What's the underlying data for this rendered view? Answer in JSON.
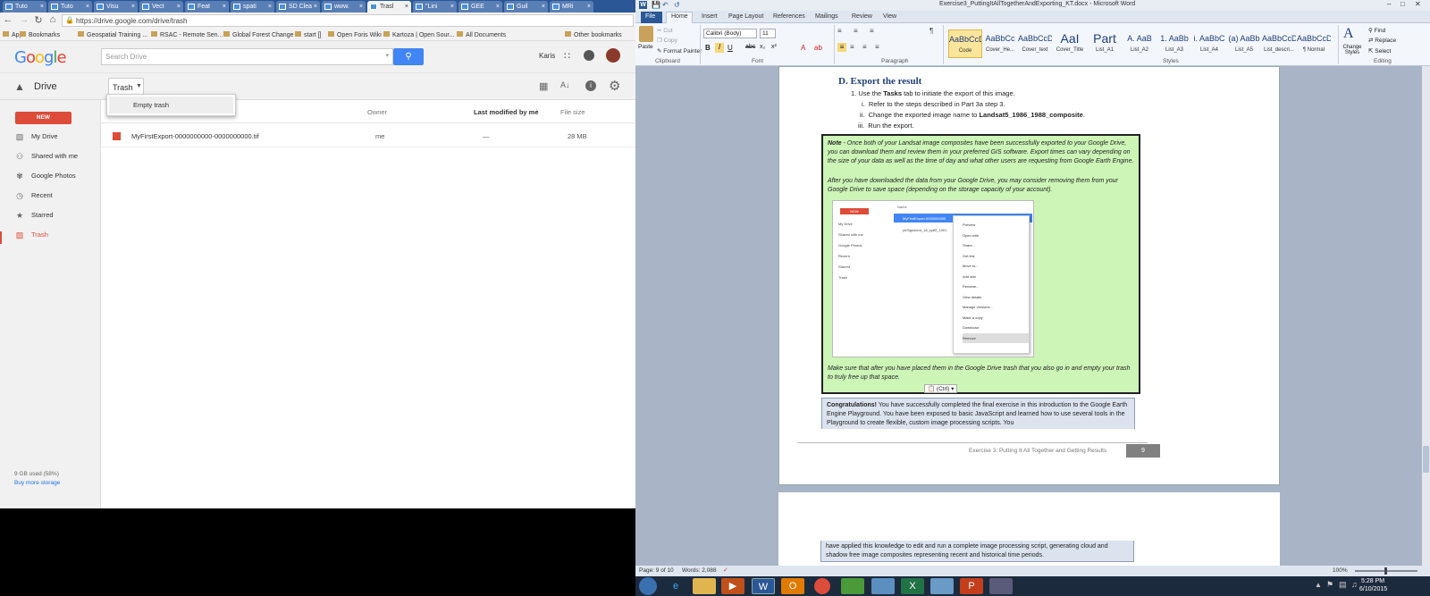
{
  "chrome": {
    "tabs": [
      {
        "label": "Tuto"
      },
      {
        "label": "Tuto"
      },
      {
        "label": "Visu"
      },
      {
        "label": "Vect"
      },
      {
        "label": "Feat"
      },
      {
        "label": "spati"
      },
      {
        "label": "SD Clea"
      },
      {
        "label": "www."
      },
      {
        "label": "Trasl"
      },
      {
        "label": "\"Lini"
      },
      {
        "label": "GEE"
      },
      {
        "label": "Guil"
      },
      {
        "label": "MRi"
      }
    ],
    "url": "https://drive.google.com/drive/trash",
    "bookmarks": [
      "Apps",
      "Bookmarks",
      "Geospatial Training ...",
      "RSAC - Remote Sen...",
      "Global Forest Change",
      "start []",
      "Open Foris Wiki",
      "Kartoza | Open Sour...",
      "All Documents",
      "Other bookmarks"
    ]
  },
  "drive": {
    "logo": "Google",
    "search_placeholder": "Search Drive",
    "user_name": "Karis",
    "app_name": "Drive",
    "location_label": "Trash",
    "dropdown_item": "Empty trash",
    "new_button": "NEW",
    "sidebar": [
      {
        "label": "My Drive",
        "icon": "folder-icon"
      },
      {
        "label": "Shared with me",
        "icon": "people-icon"
      },
      {
        "label": "Google Photos",
        "icon": "photos-icon"
      },
      {
        "label": "Recent",
        "icon": "clock-icon"
      },
      {
        "label": "Starred",
        "icon": "star-icon"
      },
      {
        "label": "Trash",
        "icon": "trash-icon"
      }
    ],
    "storage_used": "9 GB used (58%)",
    "buy_storage": "Buy more storage",
    "columns": {
      "owner": "Owner",
      "modified": "Last modified by me",
      "size": "File size"
    },
    "files": [
      {
        "name": "MyFirstExport-0000000000-0000000000.tif",
        "owner": "me",
        "modified": "—",
        "size": "28 MB"
      }
    ]
  },
  "word": {
    "title": "Exercise3_PuttingItAllTogetherAndExporting_KT.docx - Microsoft Word",
    "tabs": [
      "File",
      "Home",
      "Insert",
      "Page Layout",
      "References",
      "Mailings",
      "Review",
      "View"
    ],
    "clipboard": {
      "cut": "Cut",
      "copy": "Copy",
      "format_painter": "Format Painter",
      "paste": "Paste",
      "group": "Clipboard"
    },
    "font": {
      "name": "Calibri (Body)",
      "size": "11",
      "group": "Font"
    },
    "paragraph_group": "Paragraph",
    "styles_group": "Styles",
    "editing_group": "Editing",
    "styles": [
      {
        "preview": "AaBbCcDc",
        "name": "Code"
      },
      {
        "preview": "AaBbCc",
        "name": "Cover_He..."
      },
      {
        "preview": "AaBbCcDc",
        "name": "Cover_text"
      },
      {
        "preview": "AaI",
        "name": "Cover_Title"
      },
      {
        "preview": "Part",
        "name": "List_A1"
      },
      {
        "preview": "A. AaB",
        "name": "List_A2"
      },
      {
        "preview": "1. AaBb",
        "name": "List_A3"
      },
      {
        "preview": "i. AaBbC",
        "name": "List_A4"
      },
      {
        "preview": "(a) AaBb",
        "name": "List_A5"
      },
      {
        "preview": "AaBbCcDc",
        "name": "List_descri..."
      },
      {
        "preview": "AaBbCcDc",
        "name": "¶ Normal"
      }
    ],
    "change_styles": "Change Styles",
    "editing": {
      "find": "Find",
      "replace": "Replace",
      "select": "Select"
    },
    "doc": {
      "heading": "D. Export the result",
      "step1_pre": "Use the ",
      "step1_bold": "Tasks",
      "step1_post": " tab to initiate the export of this image.",
      "sub1": "Refer to the steps described in Part 3a step 3.",
      "sub2_pre": "Change the exported image name to ",
      "sub2_bold": "Landsat5_1986_1988_composite",
      "sub2_post": ".",
      "sub3": "Run the export.",
      "note_label": "Note",
      "note_text": " - Once both of your Landsat image composites have been successfully exported to your Google Drive, you can download them and review them in your preferred GIS software. Export times can vary depending on the size of your data as well as the time of day and what other users are requesting from Google Earth Engine.",
      "note_p2": "After you have downloaded the data from your Google Drive, you may consider removing them from your Google Drive to save space (depending on the storage capacity of your account).",
      "note_p3": "Make sure that after you have placed them in the Google Drive trash that you also go in and empty your trash to truly free up that space.",
      "paste_tag": "(Ctrl)",
      "congrats_bold": "Congratulations!",
      "congrats_text": " You have successfully completed the final exercise in this introduction to the Google Earth Engine Playground. You have been exposed to basic JavaScript and learned how to use several tools in the Playground to create flexible, custom image processing scripts. You",
      "footer": "Exercise 3: Putting It All Together and Getting Results",
      "page_no": "9",
      "page2_text": "have applied this knowledge to edit and run a complete image processing script, generating cloud and shadow free image composites representing recent and historical time periods.",
      "shot": {
        "new": "NEW",
        "name_col": "Name",
        "side": [
          "My Drive",
          "Shared with me",
          "Google Photos",
          "Recent",
          "Starred",
          "Trash"
        ],
        "file1": "MyFirstExport-0000000000",
        "file2": "yhSigsment_18_cy80_1001",
        "menu": [
          "Preview",
          "Open with",
          "Share...",
          "Get link",
          "Move to...",
          "Add star",
          "Rename...",
          "View details",
          "Manage versions...",
          "Make a copy",
          "Download",
          "Remove"
        ]
      }
    },
    "status": {
      "page": "Page: 9 of 10",
      "words": "Words: 2,088",
      "zoom": "100%"
    }
  },
  "taskbar": {
    "time": "5:28 PM",
    "date": "6/10/2015"
  }
}
